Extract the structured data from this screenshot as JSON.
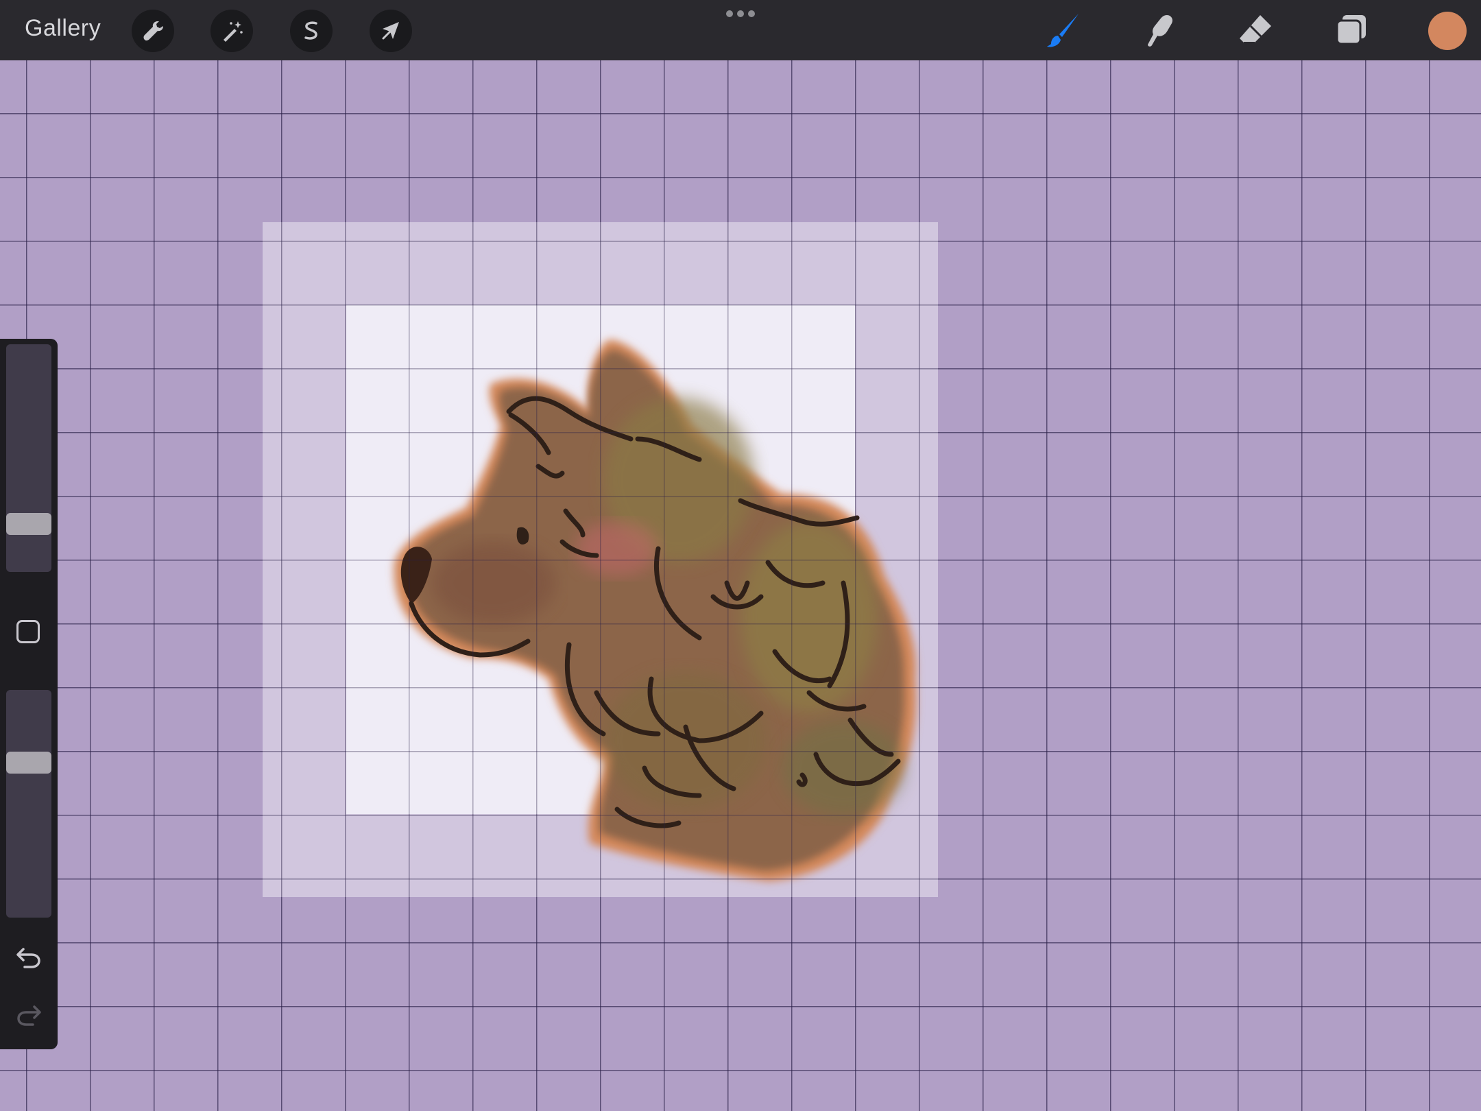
{
  "app": {
    "gallery_label": "Gallery"
  },
  "toolbar_left": [
    {
      "name": "actions",
      "icon": "wrench-icon"
    },
    {
      "name": "adjustments",
      "icon": "magic-wand-icon"
    },
    {
      "name": "selection",
      "icon": "selection-s-icon"
    },
    {
      "name": "transform",
      "icon": "arrow-cursor-icon"
    }
  ],
  "toolbar_right": [
    {
      "name": "brush",
      "icon": "brush-icon",
      "active": true
    },
    {
      "name": "smudge",
      "icon": "smudge-finger-icon",
      "active": false
    },
    {
      "name": "eraser",
      "icon": "eraser-icon",
      "active": false
    },
    {
      "name": "layers",
      "icon": "layers-icon",
      "active": false
    }
  ],
  "colors": {
    "accent": "#1a7cf5",
    "current_color": "#d3875f",
    "canvas_bg": "#b19fc6",
    "toolbar_bg": "#2a292e"
  },
  "sidebar": {
    "brush_size": 0.18,
    "brush_opacity": 0.7,
    "undo_enabled": true,
    "redo_enabled": false
  }
}
